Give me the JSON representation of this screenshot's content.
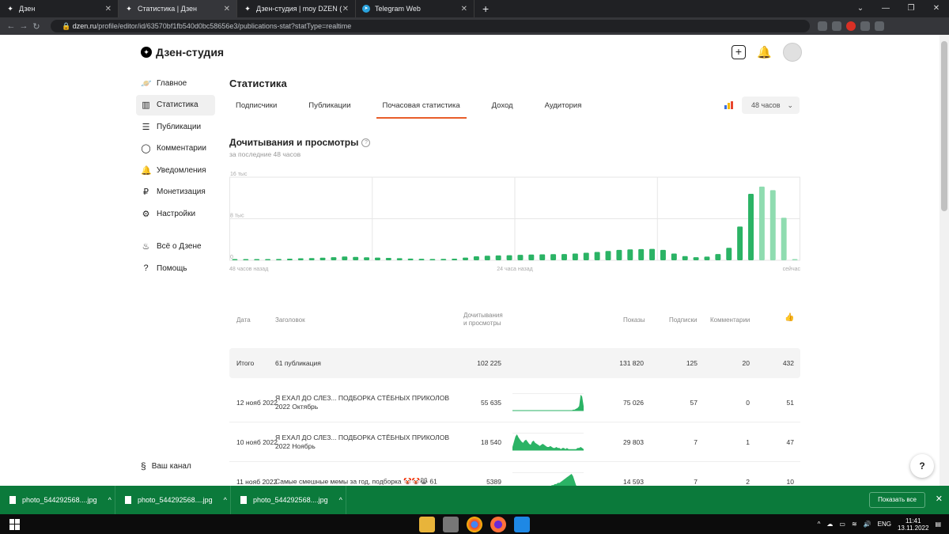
{
  "browser": {
    "tabs": [
      {
        "title": "Дзен",
        "active": false
      },
      {
        "title": "Статистика | Дзен",
        "active": true
      },
      {
        "title": "Дзен-студия | moy DZEN ( zen )",
        "active": false
      },
      {
        "title": "Telegram Web",
        "active": false
      }
    ],
    "url_host": "dzen.ru",
    "url_path": "/profile/editor/id/63570bf1fb540d0bc58656e3/publications-stat?statType=realtime"
  },
  "header": {
    "logo": "Дзен-студия"
  },
  "sidebar": {
    "items": [
      {
        "label": "Главное",
        "icon": "planet-icon",
        "active": false
      },
      {
        "label": "Статистика",
        "icon": "bar-chart-icon",
        "active": true
      },
      {
        "label": "Публикации",
        "icon": "stack-icon",
        "active": false
      },
      {
        "label": "Комментарии",
        "icon": "comment-icon",
        "active": false
      },
      {
        "label": "Уведомления",
        "icon": "bell-icon",
        "active": false
      },
      {
        "label": "Монетизация",
        "icon": "ruble-icon",
        "active": false
      },
      {
        "label": "Настройки",
        "icon": "gear-icon",
        "active": false
      }
    ],
    "items2": [
      {
        "label": "Всё о Дзене",
        "icon": "flame-icon"
      },
      {
        "label": "Помощь",
        "icon": "help-icon"
      }
    ],
    "bottom": "Ваш канал"
  },
  "main": {
    "title": "Статистика",
    "tabs": [
      "Подписчики",
      "Публикации",
      "Почасовая статистика",
      "Доход",
      "Аудитория"
    ],
    "active_tab": 2,
    "period": "48 часов",
    "section_title": "Дочитывания и просмотры",
    "section_sub": "за последние 48 часов"
  },
  "chart_data": {
    "type": "bar",
    "title": "Дочитывания и просмотры",
    "y_ticks": [
      "16 тыс",
      "8 тыс",
      "0"
    ],
    "x_ticks": [
      "48 часов назад",
      "24 часа назад",
      "сейчас"
    ],
    "ylim": [
      0,
      16000
    ],
    "grid": true,
    "colors": {
      "solid": "#2bb365",
      "light": "#8fdcb0"
    },
    "values": [
      120,
      150,
      180,
      200,
      250,
      300,
      380,
      420,
      500,
      600,
      720,
      650,
      580,
      520,
      460,
      400,
      330,
      280,
      240,
      260,
      300,
      520,
      760,
      880,
      940,
      980,
      1050,
      1100,
      1150,
      1180,
      1200,
      1300,
      1450,
      1600,
      1800,
      2000,
      2100,
      2150,
      2200,
      2000,
      1300,
      800,
      600,
      700,
      1200,
      2400,
      6500,
      12800,
      14200,
      13500,
      8200,
      150
    ],
    "light_from_index": 48
  },
  "table": {
    "headers": [
      "Дата",
      "Заголовок",
      "Дочитывания\nи просмотры",
      "Показы",
      "Подписки",
      "Комментарии"
    ],
    "total": {
      "label": "Итого",
      "title": "61 публикация",
      "reads": "102 225",
      "shows": "131 820",
      "subs": "125",
      "comments": "20",
      "likes": "432"
    },
    "rows": [
      {
        "date": "12 нояб 2022",
        "title": "Я ЕХАЛ ДО СЛЕЗ... ПОДБОРКА СТЁБНЫХ ПРИКОЛОВ 2022 Октябрь",
        "reads": "55 635",
        "shows": "75 026",
        "subs": "57",
        "comments": "0",
        "likes": "51",
        "spark": [
          0,
          0,
          0,
          0,
          0,
          0,
          0,
          0,
          0,
          0,
          0,
          0,
          0,
          0,
          0,
          0,
          0,
          0,
          0,
          0,
          0,
          0,
          0,
          0,
          0,
          0,
          0,
          0,
          0,
          0,
          0,
          0,
          0,
          0,
          0,
          0,
          0,
          0,
          0,
          0,
          1,
          1,
          2,
          3,
          5,
          18,
          16,
          5
        ]
      },
      {
        "date": "10 нояб 2022",
        "title": "Я ЕХАЛ ДО СЛЕЗ... ПОДБОРКА СТЁБНЫХ ПРИКОЛОВ 2022 Ноябрь",
        "reads": "18 540",
        "shows": "29 803",
        "subs": "7",
        "comments": "1",
        "likes": "47",
        "spark": [
          3,
          8,
          13,
          15,
          12,
          10,
          8,
          7,
          9,
          10,
          8,
          6,
          5,
          8,
          9,
          7,
          6,
          5,
          4,
          5,
          6,
          5,
          4,
          3,
          3,
          4,
          3,
          2,
          2,
          3,
          2,
          2,
          1,
          2,
          2,
          1,
          2,
          1,
          1,
          1,
          1,
          1,
          1,
          2,
          2,
          3,
          2,
          1
        ]
      },
      {
        "date": "11 нояб 2022",
        "title": "Самые смешные мемы за год, подборка 🤡🤡😹 61",
        "reads": "5389",
        "shows": "14 593",
        "subs": "7",
        "comments": "2",
        "likes": "10",
        "spark": [
          0,
          0,
          0,
          0,
          0,
          0,
          0,
          0,
          0,
          0,
          0,
          0,
          0,
          0,
          0,
          0,
          1,
          1,
          1,
          1,
          2,
          2,
          2,
          3,
          3,
          3,
          4,
          4,
          5,
          5,
          6,
          6,
          7,
          8,
          9,
          10,
          11,
          12,
          13,
          14,
          12,
          8,
          4,
          2,
          1,
          0,
          0,
          0
        ]
      }
    ]
  },
  "downloads": {
    "files": [
      "photo_544292568....jpg",
      "photo_544292568....jpg",
      "photo_544292568....jpg"
    ],
    "show_all": "Показать все"
  },
  "taskbar": {
    "lang": "ENG",
    "time": "11:41",
    "date": "13.11.2022"
  }
}
